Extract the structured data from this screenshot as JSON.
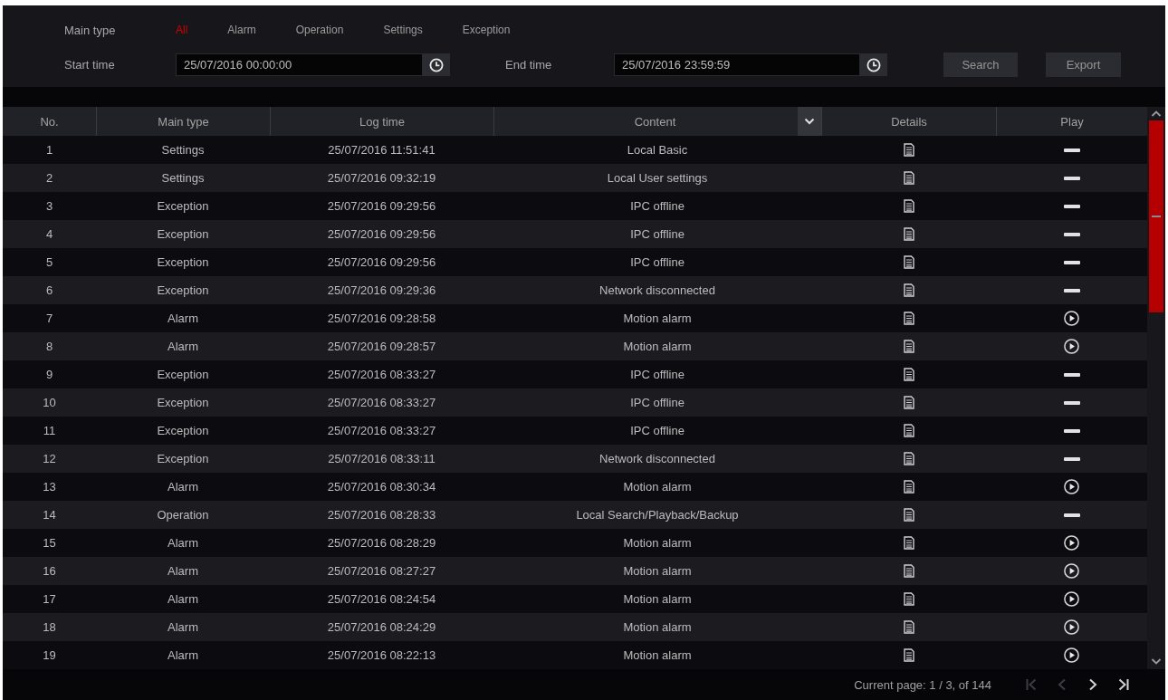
{
  "filters": {
    "main_type": {
      "label": "Main type",
      "options": [
        {
          "label": "All",
          "selected": true
        },
        {
          "label": "Alarm",
          "selected": false
        },
        {
          "label": "Operation",
          "selected": false
        },
        {
          "label": "Settings",
          "selected": false
        },
        {
          "label": "Exception",
          "selected": false
        }
      ]
    },
    "start_time": {
      "label": "Start time",
      "value": "25/07/2016 00:00:00"
    },
    "end_time": {
      "label": "End time",
      "value": "25/07/2016 23:59:59"
    },
    "buttons": [
      "Search",
      "Export"
    ]
  },
  "table": {
    "columns": [
      {
        "label": "No.",
        "dropdown": false
      },
      {
        "label": "Main type",
        "dropdown": false
      },
      {
        "label": "Log time",
        "dropdown": false
      },
      {
        "label": "Content",
        "dropdown": true
      },
      {
        "label": "Details",
        "dropdown": false
      },
      {
        "label": "Play",
        "dropdown": false
      }
    ],
    "rows": [
      {
        "no": "1",
        "main_type": "Settings",
        "log_time": "25/07/2016 11:51:41",
        "content": "Local Basic",
        "playable": false
      },
      {
        "no": "2",
        "main_type": "Settings",
        "log_time": "25/07/2016 09:32:19",
        "content": "Local User settings",
        "playable": false
      },
      {
        "no": "3",
        "main_type": "Exception",
        "log_time": "25/07/2016 09:29:56",
        "content": "IPC offline",
        "playable": false
      },
      {
        "no": "4",
        "main_type": "Exception",
        "log_time": "25/07/2016 09:29:56",
        "content": "IPC offline",
        "playable": false
      },
      {
        "no": "5",
        "main_type": "Exception",
        "log_time": "25/07/2016 09:29:56",
        "content": "IPC offline",
        "playable": false
      },
      {
        "no": "6",
        "main_type": "Exception",
        "log_time": "25/07/2016 09:29:36",
        "content": "Network disconnected",
        "playable": false
      },
      {
        "no": "7",
        "main_type": "Alarm",
        "log_time": "25/07/2016 09:28:58",
        "content": "Motion alarm",
        "playable": true
      },
      {
        "no": "8",
        "main_type": "Alarm",
        "log_time": "25/07/2016 09:28:57",
        "content": "Motion alarm",
        "playable": true
      },
      {
        "no": "9",
        "main_type": "Exception",
        "log_time": "25/07/2016 08:33:27",
        "content": "IPC offline",
        "playable": false
      },
      {
        "no": "10",
        "main_type": "Exception",
        "log_time": "25/07/2016 08:33:27",
        "content": "IPC offline",
        "playable": false
      },
      {
        "no": "11",
        "main_type": "Exception",
        "log_time": "25/07/2016 08:33:27",
        "content": "IPC offline",
        "playable": false
      },
      {
        "no": "12",
        "main_type": "Exception",
        "log_time": "25/07/2016 08:33:11",
        "content": "Network disconnected",
        "playable": false
      },
      {
        "no": "13",
        "main_type": "Alarm",
        "log_time": "25/07/2016 08:30:34",
        "content": "Motion alarm",
        "playable": true
      },
      {
        "no": "14",
        "main_type": "Operation",
        "log_time": "25/07/2016 08:28:33",
        "content": "Local Search/Playback/Backup",
        "playable": false
      },
      {
        "no": "15",
        "main_type": "Alarm",
        "log_time": "25/07/2016 08:28:29",
        "content": "Motion alarm",
        "playable": true
      },
      {
        "no": "16",
        "main_type": "Alarm",
        "log_time": "25/07/2016 08:27:27",
        "content": "Motion alarm",
        "playable": true
      },
      {
        "no": "17",
        "main_type": "Alarm",
        "log_time": "25/07/2016 08:24:54",
        "content": "Motion alarm",
        "playable": true
      },
      {
        "no": "18",
        "main_type": "Alarm",
        "log_time": "25/07/2016 08:24:29",
        "content": "Motion alarm",
        "playable": true
      },
      {
        "no": "19",
        "main_type": "Alarm",
        "log_time": "25/07/2016 08:22:13",
        "content": "Motion alarm",
        "playable": true
      }
    ]
  },
  "footer": {
    "page_info": "Current page: 1 / 3, of 144",
    "pager": [
      {
        "kind": "first",
        "disabled": true
      },
      {
        "kind": "previous",
        "disabled": true
      },
      {
        "kind": "next",
        "disabled": false
      },
      {
        "kind": "last",
        "disabled": false
      }
    ]
  }
}
